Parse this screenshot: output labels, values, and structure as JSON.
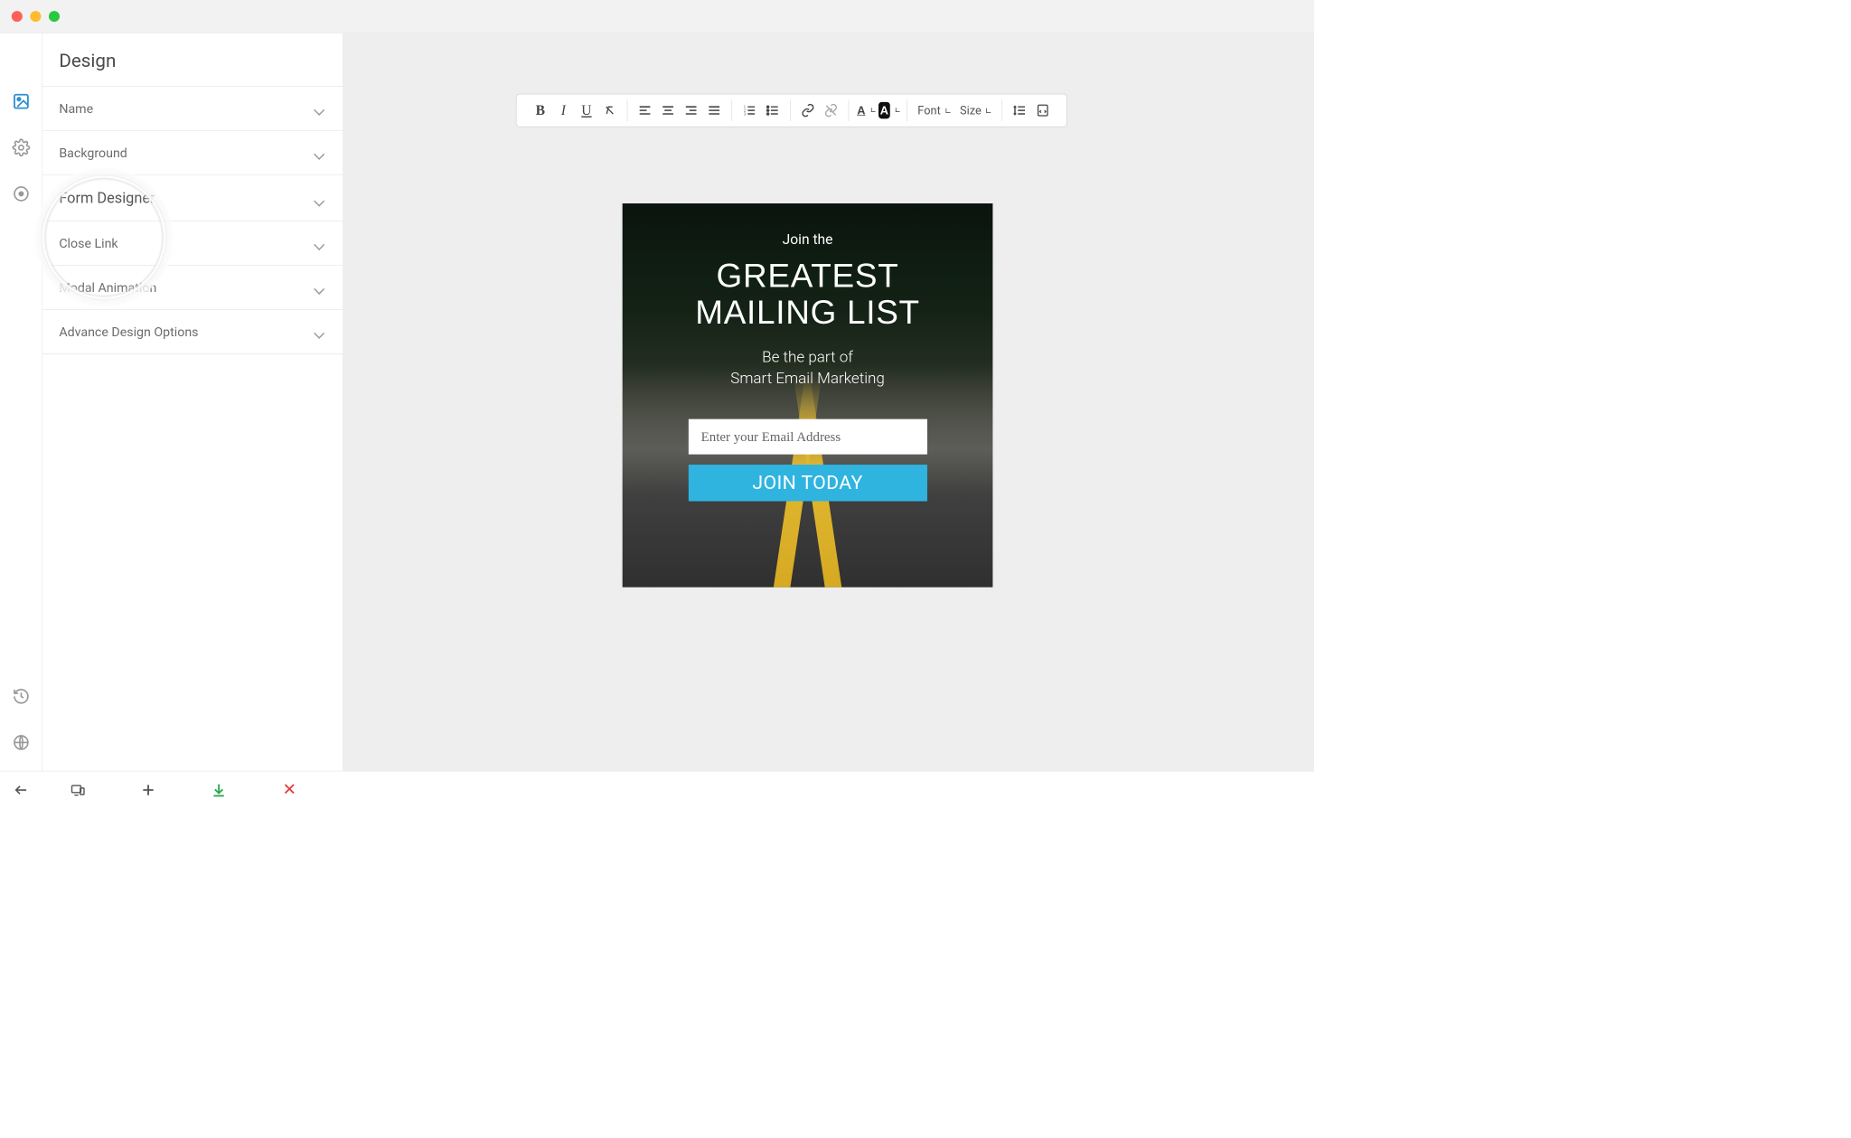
{
  "mac": {
    "title": ""
  },
  "sidebar": {
    "title": "Design",
    "items": [
      {
        "label": "Name"
      },
      {
        "label": "Background"
      },
      {
        "label": "Form Designer"
      },
      {
        "label": "Close Link"
      },
      {
        "label": "Modal Animation"
      },
      {
        "label": "Advance Design Options"
      }
    ]
  },
  "rail": {
    "icons": [
      "image-icon",
      "gear-icon",
      "target-icon"
    ],
    "bottom_icons": [
      "history-icon",
      "globe-icon"
    ]
  },
  "editor_toolbar": {
    "font_label": "Font",
    "size_label": "Size"
  },
  "modal": {
    "kicker": "Join the",
    "headline_line1": "GREATEST",
    "headline_line2": "MAILING LIST",
    "sub_line1": "Be the part of",
    "sub_line2": "Smart Email Marketing",
    "email_placeholder": "Enter your Email Address",
    "button_label": "JOIN TODAY"
  },
  "bottom_bar": {
    "back_icon": "arrow-left-icon",
    "devices_icon": "devices-icon",
    "add_icon": "plus-icon",
    "download_icon": "download-icon",
    "close_label": "✕"
  },
  "colors": {
    "accent_button": "#2fb4e0",
    "download_green": "#2fa84f",
    "close_red": "#e03b3b"
  }
}
